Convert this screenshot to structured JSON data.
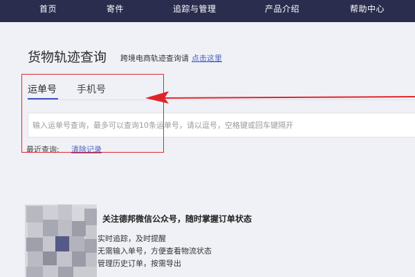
{
  "nav": {
    "items": [
      {
        "label": "首页"
      },
      {
        "label": "寄件"
      },
      {
        "label": "追踪与管理"
      },
      {
        "label": "产品介绍"
      },
      {
        "label": "帮助中心"
      }
    ]
  },
  "tracking": {
    "title": "货物轨迹查询",
    "cross_border_text": "跨境电商轨迹查询请",
    "cross_border_link": "点击这里",
    "tabs": [
      {
        "label": "运单号",
        "active": true
      },
      {
        "label": "手机号",
        "active": false
      }
    ],
    "search_placeholder": "输入运单号查询，最多可以查询10条运单号，请以逗号，空格键或回车键隔开",
    "search_value": "",
    "recent_label": "最近查询:",
    "recent_clear": "清除记录"
  },
  "promo": {
    "title": "关注德邦微信公众号，随时掌握订单状态",
    "lines": [
      "实时追踪，及时提醒",
      "无需输入单号，方便查看物流状态",
      "管理历史订单，按需导出"
    ]
  },
  "colors": {
    "nav_bg": "#2a2d4e",
    "page_bg": "#eff1f6",
    "accent": "#3b4fbf",
    "link": "#4a5fc1",
    "annotation": "#e0232a"
  }
}
